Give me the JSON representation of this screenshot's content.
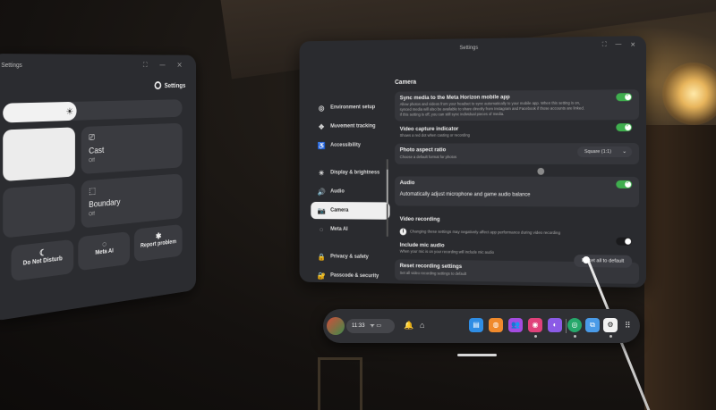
{
  "quick_settings": {
    "title": "Settings",
    "window_controls": "⛶ — ✕",
    "settings_button": "Settings",
    "tiles": {
      "cast": {
        "label": "Cast",
        "sub": "Off"
      },
      "boundary": {
        "label": "Boundary",
        "sub": "Off"
      }
    },
    "buttons": {
      "do_not_disturb": "Do Not Disturb",
      "meta_ai": "Meta AI",
      "report_problem": "Report problem"
    }
  },
  "window": {
    "title": "Settings",
    "controls": [
      "⛶",
      "—",
      "✕"
    ]
  },
  "nav": {
    "items": [
      {
        "label": "Environment setup",
        "icon": "◎"
      },
      {
        "label": "Movement tracking",
        "icon": "✥"
      },
      {
        "label": "Accessibility",
        "icon": "♿"
      },
      {
        "label": "Display & brightness",
        "icon": "☀"
      },
      {
        "label": "Audio",
        "icon": "🔊"
      },
      {
        "label": "Camera",
        "icon": "📷"
      },
      {
        "label": "Meta AI",
        "icon": "◌"
      },
      {
        "label": "Privacy & safety",
        "icon": "🔒"
      },
      {
        "label": "Passcode & security",
        "icon": "🔐"
      }
    ]
  },
  "camera": {
    "section_title": "Camera",
    "sync": {
      "title": "Sync media to the Meta Horizon mobile app",
      "desc1": "Allow photos and videos from your headset to sync automatically to your mobile app. When this setting is on,",
      "desc2": "synced media will also be available to share directly from Instagram and Facebook if those accounts are linked.",
      "desc3": "If this setting is off, you can still sync individual pieces of media."
    },
    "capture": {
      "title": "Video capture indicator",
      "desc": "Shows a red dot when casting or recording"
    },
    "aspect": {
      "title": "Photo aspect ratio",
      "desc": "Choose a default format for photos",
      "value": "Square (1:1)"
    },
    "audio": {
      "title": "Audio",
      "auto_adjust": "Automatically adjust microphone and game audio balance"
    },
    "video": {
      "section_title": "Video recording",
      "warning": "Changing these settings may negatively affect app performance during video recording",
      "mic_title": "Include mic audio",
      "mic_desc": "When your mic is on your recording will include mic audio",
      "reset_title": "Reset recording settings",
      "reset_desc": "Set all video recording settings to default",
      "reset_button": "Reset all to default"
    }
  },
  "taskbar": {
    "time": "11:33",
    "status_icons": "ᯤ ▭",
    "apps": [
      {
        "name": "files",
        "color": "#2f8de4",
        "glyph": "▤"
      },
      {
        "name": "store",
        "color": "#f08a2c",
        "glyph": "◍"
      },
      {
        "name": "people",
        "color": "#a44ce0",
        "glyph": "👥"
      },
      {
        "name": "camera",
        "color": "#e0417a",
        "glyph": "◉"
      },
      {
        "name": "horizon",
        "color": "#8b5be6",
        "glyph": "◐"
      },
      {
        "name": "app-green",
        "color": "#26a86b",
        "glyph": "◎"
      },
      {
        "name": "app-blue",
        "color": "#4a9be8",
        "glyph": "⧉"
      },
      {
        "name": "settings",
        "color": "#f2f2f2",
        "glyph": "⚙"
      }
    ]
  }
}
